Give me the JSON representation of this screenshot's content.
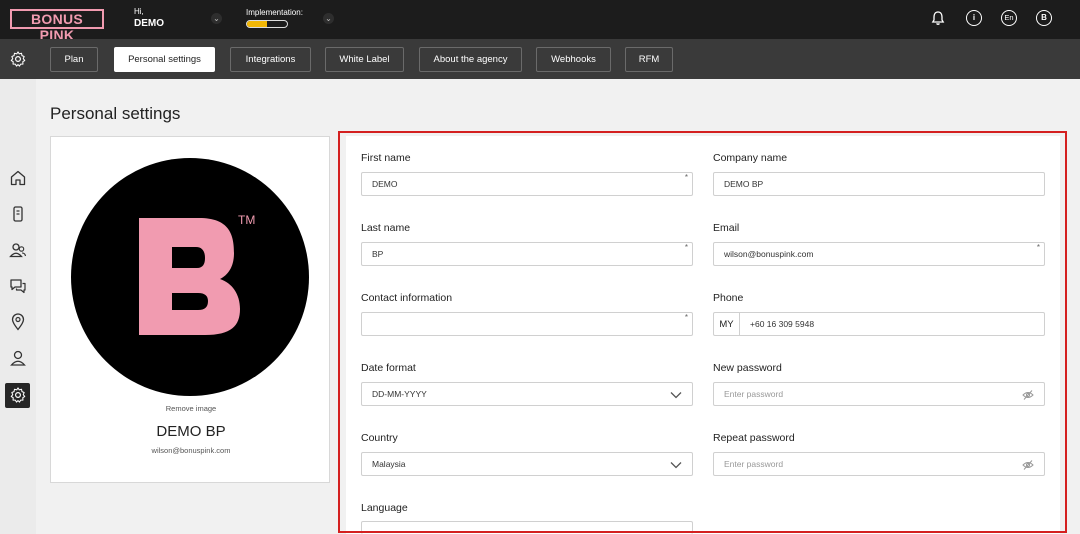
{
  "brand": {
    "logo_text": "BONUS PINK",
    "accent": "#f19bb0"
  },
  "user": {
    "greeting": "Hi,",
    "name": "DEMO"
  },
  "implementation": {
    "label": "Implementation:",
    "progress": 0.5
  },
  "topbar": {
    "lang": "En",
    "account_initial": "B",
    "icons": [
      "bell-icon",
      "info-icon",
      "language-icon",
      "account-icon"
    ]
  },
  "tabs": [
    {
      "label": "Plan"
    },
    {
      "label": "Personal settings",
      "active": true
    },
    {
      "label": "Integrations"
    },
    {
      "label": "White Label"
    },
    {
      "label": "About the agency"
    },
    {
      "label": "Webhooks"
    },
    {
      "label": "RFM"
    }
  ],
  "sidebar": {
    "items": [
      "home-icon",
      "device-icon",
      "users-icon",
      "chat-icon",
      "location-icon",
      "user-icon",
      "gear-icon"
    ],
    "active": "gear-icon"
  },
  "page": {
    "title": "Personal settings"
  },
  "profile": {
    "avatar_letter": "B",
    "avatar_tm": "TM",
    "remove_image": "Remove image",
    "name": "DEMO BP",
    "email": "wilson@bonuspink.com"
  },
  "form": {
    "first_name": {
      "label": "First name",
      "value": "DEMO",
      "required": "*"
    },
    "company_name": {
      "label": "Company name",
      "value": "DEMO BP"
    },
    "last_name": {
      "label": "Last name",
      "value": "BP",
      "required": "*"
    },
    "email": {
      "label": "Email",
      "value": "wilson@bonuspink.com",
      "required": "*"
    },
    "contact_info": {
      "label": "Contact information",
      "value": "",
      "required": "*"
    },
    "phone": {
      "label": "Phone",
      "country_code": "MY",
      "value": "+60 16 309 5948"
    },
    "date_format": {
      "label": "Date format",
      "value": "DD-MM-YYYY"
    },
    "new_password": {
      "label": "New password",
      "placeholder": "Enter password"
    },
    "country": {
      "label": "Country",
      "value": "Malaysia"
    },
    "repeat_password": {
      "label": "Repeat password",
      "placeholder": "Enter password"
    },
    "language": {
      "label": "Language"
    }
  }
}
